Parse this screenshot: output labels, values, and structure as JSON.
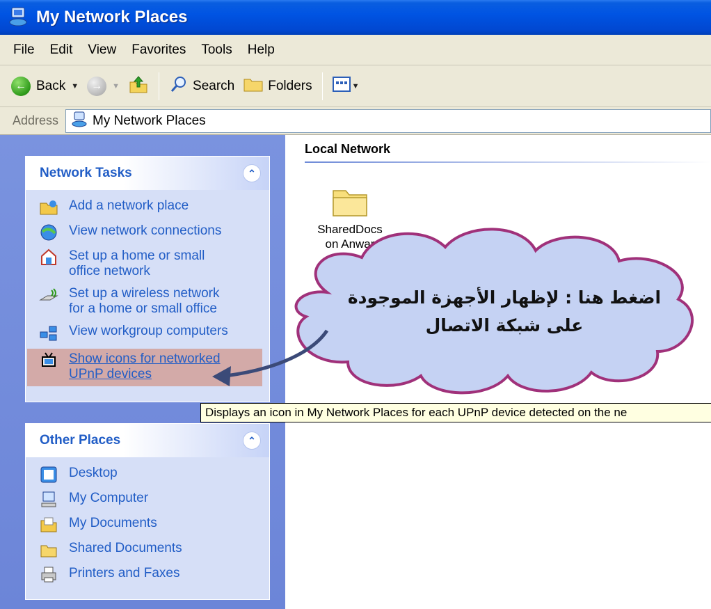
{
  "window": {
    "title": "My Network Places"
  },
  "menu": [
    "File",
    "Edit",
    "View",
    "Favorites",
    "Tools",
    "Help"
  ],
  "toolbar": {
    "back_label": "Back",
    "search_label": "Search",
    "folders_label": "Folders"
  },
  "address": {
    "label": "Address",
    "value": "My Network Places"
  },
  "network_tasks": {
    "title": "Network Tasks",
    "items": [
      {
        "label_lines": [
          "Add a network place"
        ],
        "icon": "add-network-place-icon"
      },
      {
        "label_lines": [
          "View network connections"
        ],
        "icon": "network-connections-icon"
      },
      {
        "label_lines": [
          "Set up a home or small",
          "office network"
        ],
        "icon": "home-network-icon"
      },
      {
        "label_lines": [
          "Set up a wireless network",
          "for a home or small office"
        ],
        "icon": "wireless-network-icon"
      },
      {
        "label_lines": [
          "View workgroup computers"
        ],
        "icon": "workgroup-computers-icon"
      },
      {
        "label_lines": [
          "Show icons for networked",
          "UPnP devices"
        ],
        "icon": "upnp-devices-icon"
      }
    ]
  },
  "other_places": {
    "title": "Other Places",
    "items": [
      {
        "label": "Desktop",
        "icon": "desktop-icon"
      },
      {
        "label": "My Computer",
        "icon": "my-computer-icon"
      },
      {
        "label": "My Documents",
        "icon": "my-documents-icon"
      },
      {
        "label": "Shared Documents",
        "icon": "shared-documents-icon"
      },
      {
        "label": "Printers and Faxes",
        "icon": "printers-faxes-icon"
      }
    ]
  },
  "content": {
    "group_title": "Local Network",
    "folder": {
      "line1": "SharedDocs",
      "line2": "on Anwar"
    }
  },
  "tooltip": "Displays an icon in My Network Places for each UPnP device detected on the ne",
  "callout": {
    "line1": "اضغط هنا : لإظهار الأجهزة الموجودة",
    "line2": "على شبكة الاتصال"
  },
  "colors": {
    "title_bar": "#0054e3",
    "task_link": "#215dc6",
    "pane_bg": "#7a93df",
    "highlight": "#d3aaa8",
    "cloud_fill": "#bfcdf2",
    "cloud_stroke": "#a0317a"
  }
}
